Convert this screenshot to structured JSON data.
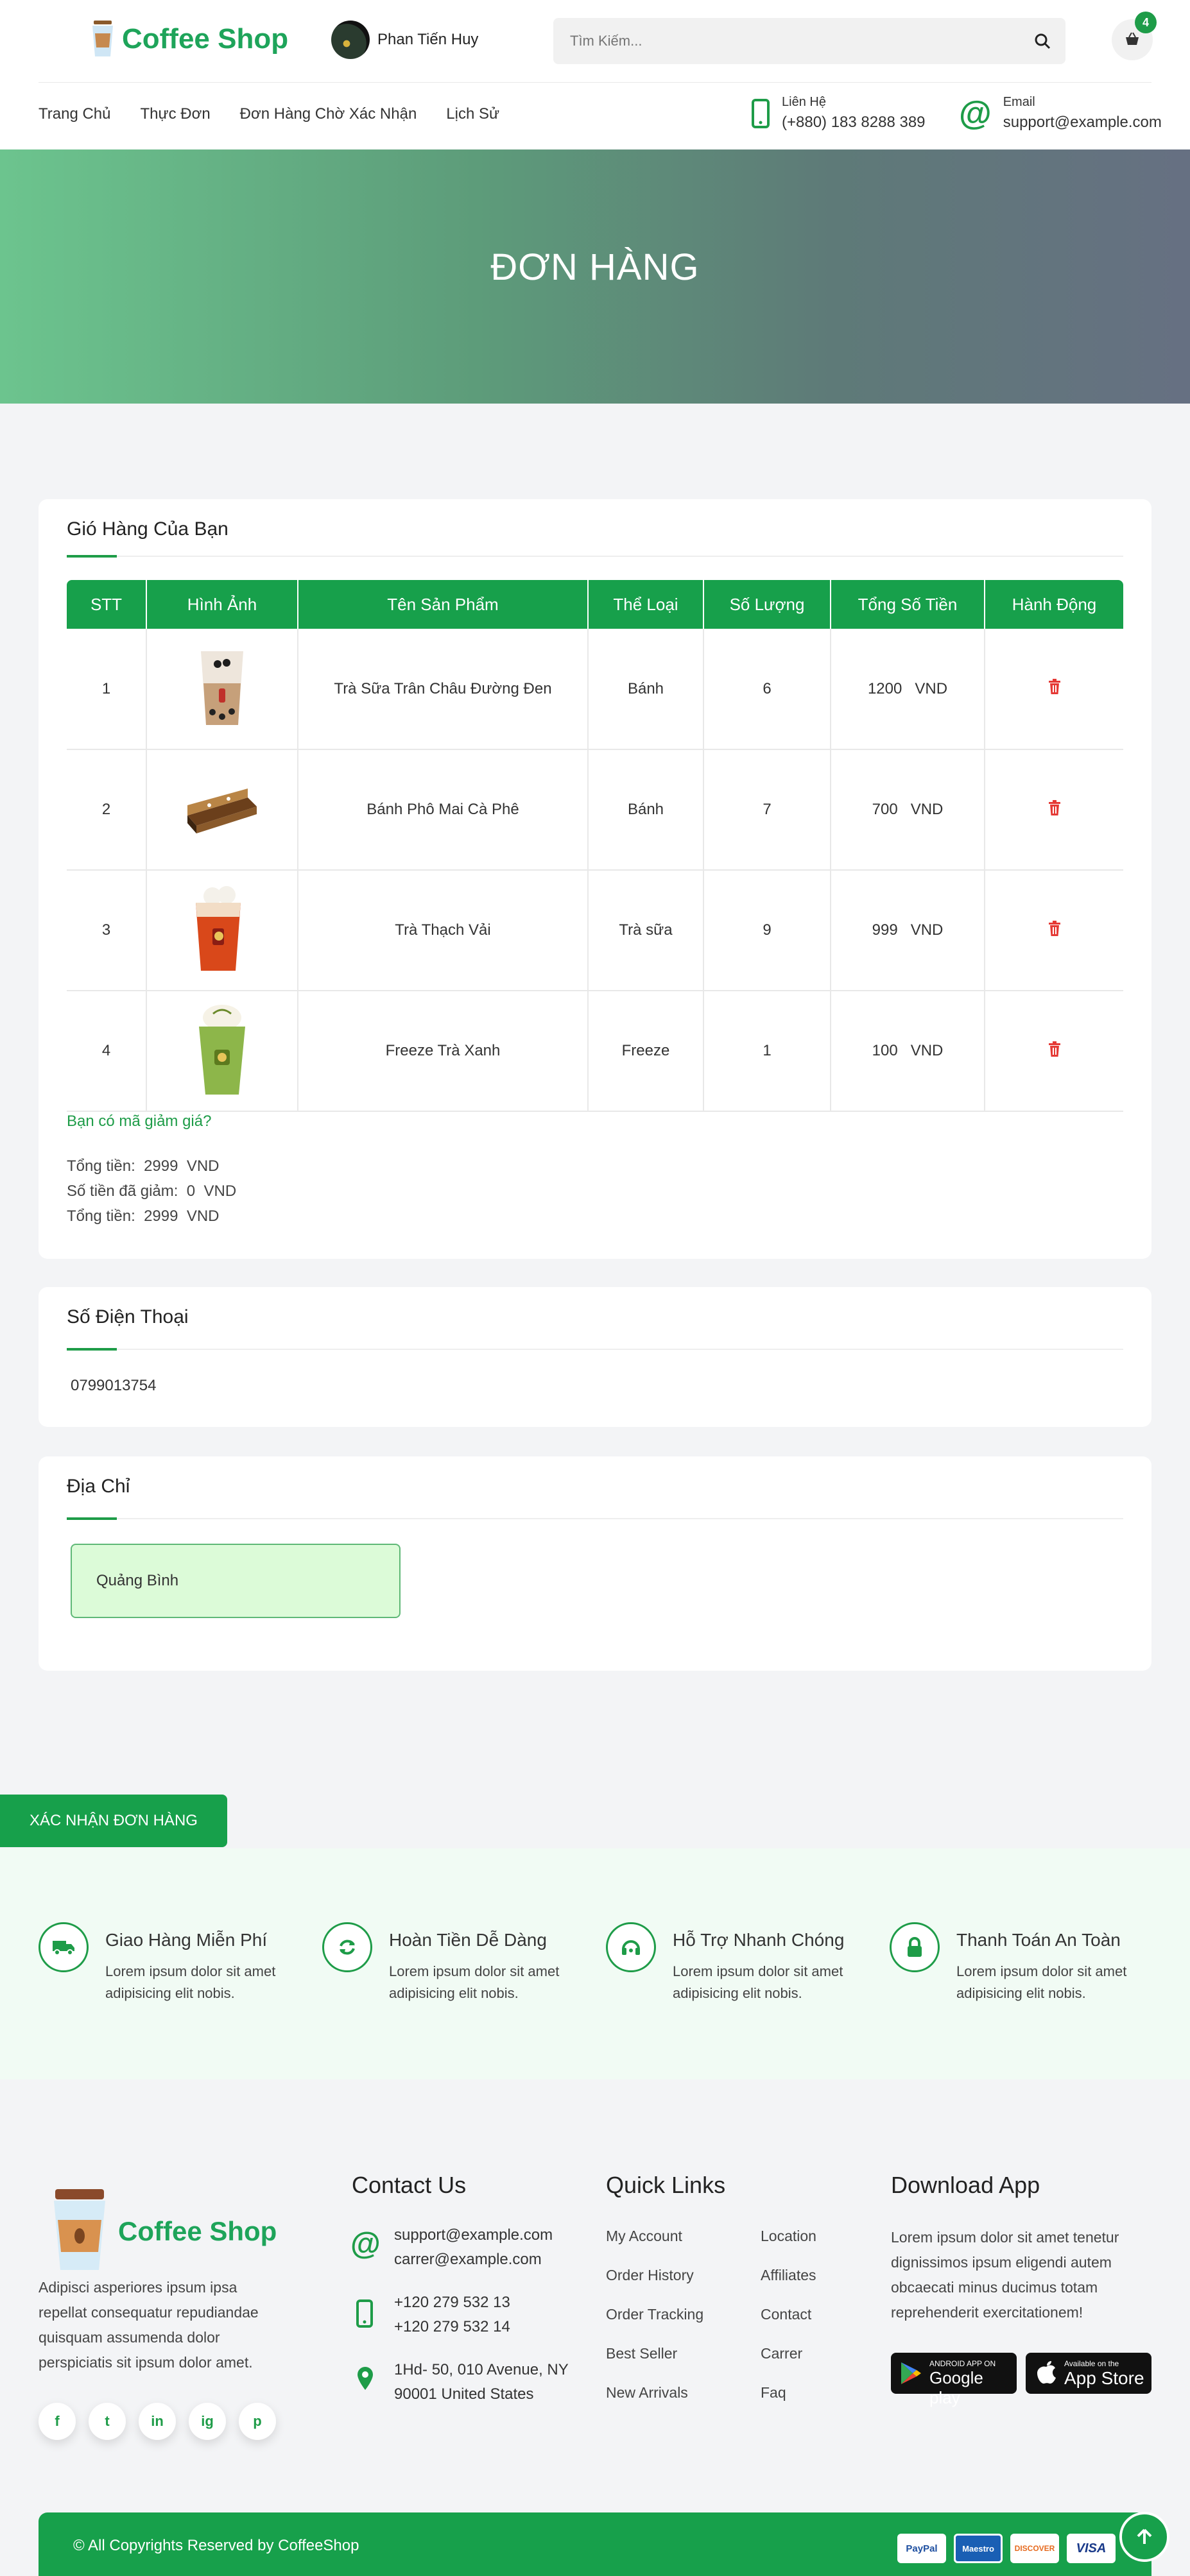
{
  "header": {
    "logo_text": "Coffee Shop",
    "user_name": "Phan Tiến Huy",
    "search_placeholder": "Tìm Kiếm...",
    "cart_count": "4"
  },
  "nav": {
    "items": [
      "Trang Chủ",
      "Thực Đơn",
      "Đơn Hàng Chờ Xác Nhận",
      "Lịch Sử"
    ]
  },
  "contact": {
    "phone_label": "Liên Hệ",
    "phone_value": "(+880) 183 8288 389",
    "email_label": "Email",
    "email_value": "support@example.com"
  },
  "hero": {
    "title": "ĐƠN HÀNG"
  },
  "cart": {
    "title": "Gió Hàng Của Bạn",
    "columns": [
      "STT",
      "Hình Ảnh",
      "Tên Sản Phẩm",
      "Thể Loại",
      "Số Lượng",
      "Tổng Số Tiền",
      "Hành Động"
    ],
    "rows": [
      {
        "stt": "1",
        "image": "milk-tea-image",
        "name": "Trà Sữa Trân Châu Đường Đen",
        "category": "Bánh",
        "quantity": "6",
        "total": "1200",
        "currency": "VND"
      },
      {
        "stt": "2",
        "image": "cake-image",
        "name": "Bánh Phô Mai Cà Phê",
        "category": "Bánh",
        "quantity": "7",
        "total": "700",
        "currency": "VND"
      },
      {
        "stt": "3",
        "image": "lychee-tea-image",
        "name": "Trà Thạch Vải",
        "category": "Trà sữa",
        "quantity": "9",
        "total": "999",
        "currency": "VND"
      },
      {
        "stt": "4",
        "image": "green-tea-freeze-image",
        "name": "Freeze Trà Xanh",
        "category": "Freeze",
        "quantity": "1",
        "total": "100",
        "currency": "VND"
      }
    ],
    "promo_link": "Bạn có mã giảm giá?",
    "subtotal_label": "Tổng tiền:",
    "subtotal_value": "2999",
    "discount_label": "Số tiền đã giảm:",
    "discount_value": "0",
    "total_label": "Tổng tiền:",
    "total_value": "2999",
    "currency": "VND"
  },
  "phone_card": {
    "title": "Số Điện Thoại",
    "value": "0799013754"
  },
  "address_card": {
    "title": "Địa Chỉ",
    "value": "Quảng Bình"
  },
  "confirm_button": "XÁC NHẬN ĐƠN HÀNG",
  "features": [
    {
      "icon": "truck-icon",
      "title": "Giao Hàng Miễn Phí",
      "desc": "Lorem ipsum dolor sit amet adipisicing elit nobis."
    },
    {
      "icon": "refresh-icon",
      "title": "Hoàn Tiền Dễ Dàng",
      "desc": "Lorem ipsum dolor sit amet adipisicing elit nobis."
    },
    {
      "icon": "headset-icon",
      "title": "Hỗ Trợ Nhanh Chóng",
      "desc": "Lorem ipsum dolor sit amet adipisicing elit nobis."
    },
    {
      "icon": "lock-icon",
      "title": "Thanh Toán An Toàn",
      "desc": "Lorem ipsum dolor sit amet adipisicing elit nobis."
    }
  ],
  "footer": {
    "logo_text": "Coffee Shop",
    "about": "Adipisci asperiores ipsum ipsa repellat consequatur repudiandae quisquam assumenda dolor perspiciatis sit ipsum dolor amet.",
    "social": [
      "f",
      "t",
      "in",
      "ig",
      "p"
    ],
    "contact_title": "Contact Us",
    "emails": [
      "support@example.com",
      "carrer@example.com"
    ],
    "phones": [
      "+120 279 532 13",
      "+120 279 532 14"
    ],
    "address": [
      "1Hd- 50, 010 Avenue, NY",
      "90001 United States"
    ],
    "quick_title": "Quick Links",
    "links_col1": [
      "My Account",
      "Order History",
      "Order Tracking",
      "Best Seller",
      "New Arrivals"
    ],
    "links_col2": [
      "Location",
      "Affiliates",
      "Contact",
      "Carrer",
      "Faq"
    ],
    "app_title": "Download App",
    "app_desc": "Lorem ipsum dolor sit amet tenetur dignissimos ipsum eligendi autem obcaecati minus ducimus totam reprehenderit exercitationem!",
    "google_small": "ANDROID APP ON",
    "google_big": "Google play",
    "apple_small": "Available on the",
    "apple_big": "App Store",
    "copyright": "© All Copyrights Reserved by CoffeeShop",
    "payments": [
      "PayPal",
      "Maestro",
      "DISCOVER",
      "VISA"
    ]
  },
  "colors": {
    "brand": "#17a04b",
    "hero_start": "#6cc48e",
    "hero_end": "#667082"
  }
}
